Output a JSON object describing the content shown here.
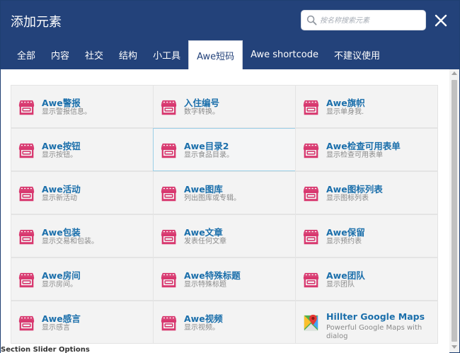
{
  "dialog": {
    "title": "添加元素",
    "search_placeholder": "按名称搜索元素"
  },
  "tabs": [
    {
      "label": "全部"
    },
    {
      "label": "内容"
    },
    {
      "label": "社交"
    },
    {
      "label": "结构"
    },
    {
      "label": "小工具"
    },
    {
      "label": "Awe短码",
      "active": true
    },
    {
      "label": "Awe shortcode"
    },
    {
      "label": "不建议使用"
    }
  ],
  "elements": [
    {
      "name": "Awe警报",
      "desc": "显示警报信息。",
      "icon": "store-icon"
    },
    {
      "name": "入住编号",
      "desc": "数字转换。",
      "icon": "store-icon"
    },
    {
      "name": "Awe旗帜",
      "desc": "显示单身我.",
      "icon": "store-icon"
    },
    {
      "name": "Awe按钮",
      "desc": "显示按钮。",
      "icon": "store-icon"
    },
    {
      "name": "Awe目录2",
      "desc": "显示食品目录。",
      "icon": "store-icon",
      "highlight": true
    },
    {
      "name": "Awe检查可用表单",
      "desc": "显示检查可用表单",
      "icon": "store-icon"
    },
    {
      "name": "Awe活动",
      "desc": "显示新活动",
      "icon": "store-icon"
    },
    {
      "name": "Awe图库",
      "desc": "列出图库或专辑。",
      "icon": "store-icon"
    },
    {
      "name": "Awe图标列表",
      "desc": "显示图标列表",
      "icon": "store-icon"
    },
    {
      "name": "Awe包装",
      "desc": "显示交易和包装。",
      "icon": "store-icon"
    },
    {
      "name": "Awe文章",
      "desc": "发表任何文章",
      "icon": "store-icon"
    },
    {
      "name": "Awe保留",
      "desc": "显示预约表",
      "icon": "store-icon"
    },
    {
      "name": "Awe房间",
      "desc": "显示房间。",
      "icon": "store-icon"
    },
    {
      "name": "Awe特殊标题",
      "desc": "显示特殊标题",
      "icon": "store-icon"
    },
    {
      "name": "Awe团队",
      "desc": "显示团队",
      "icon": "store-icon"
    },
    {
      "name": "Awe感言",
      "desc": "显示感言",
      "icon": "store-icon"
    },
    {
      "name": "Awe视频",
      "desc": "显示视频。",
      "icon": "store-icon"
    },
    {
      "name": "Hillter Google Maps",
      "desc": "Powerful Google Maps with dialog",
      "icon": "google-maps-icon"
    }
  ],
  "underlay": {
    "text": "Section Slider Options"
  },
  "colors": {
    "header_bg": "#23427a",
    "element_name": "#1b6fab",
    "store_icon": "#d8386f"
  }
}
